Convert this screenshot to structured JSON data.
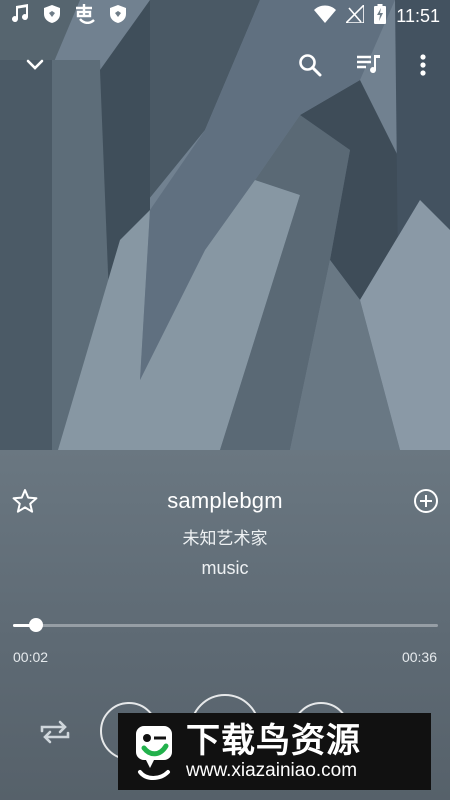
{
  "status_bar": {
    "time": "11:51",
    "left_icons": [
      "music-note-icon",
      "shield-icon",
      "app-glyph-icon",
      "shield-icon"
    ],
    "right_icons": [
      "wifi-icon",
      "no-sim-icon",
      "battery-charging-icon"
    ]
  },
  "toolbar": {
    "collapse_icon": "chevron-down-icon",
    "search_icon": "search-icon",
    "queue_icon": "queue-music-icon",
    "more_icon": "more-vert-icon"
  },
  "track": {
    "title": "samplebgm",
    "artist": "未知艺术家",
    "album": "music",
    "favorite_icon": "star-outline-icon",
    "add_icon": "add-circle-icon"
  },
  "playback": {
    "elapsed": "00:02",
    "total": "00:36",
    "progress_fraction": 0.055
  },
  "watermark": {
    "title": "下载鸟资源",
    "url": "www.xiazainiao.com"
  },
  "colors": {
    "art_light": "#7c8c99",
    "art_dark": "#3f4d59",
    "panel": "#5e6a74",
    "accent": "#ffffff"
  }
}
